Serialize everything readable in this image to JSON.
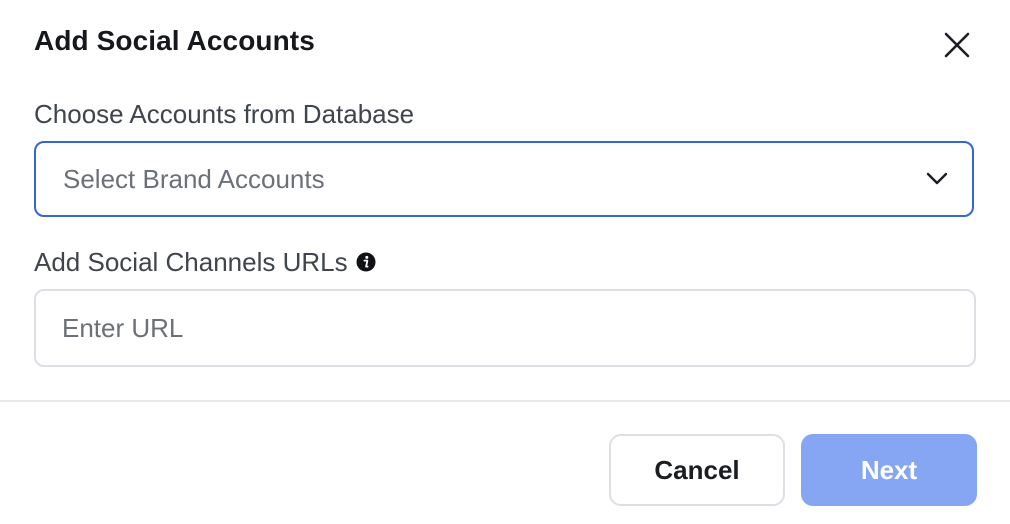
{
  "dialog": {
    "title": "Add Social Accounts",
    "close_icon": "close-icon"
  },
  "accounts_section": {
    "label": "Choose Accounts from Database",
    "select_placeholder": "Select Brand Accounts",
    "select_icon": "chevron-down-icon"
  },
  "urls_section": {
    "label": "Add Social Channels URLs",
    "info_icon": "info-icon",
    "input_value": "",
    "input_placeholder": "Enter URL"
  },
  "footer": {
    "cancel_label": "Cancel",
    "next_label": "Next"
  },
  "colors": {
    "accent_border": "#3566d6",
    "next_button_disabled": "#86a5f2",
    "divider": "#e6e8ec"
  }
}
